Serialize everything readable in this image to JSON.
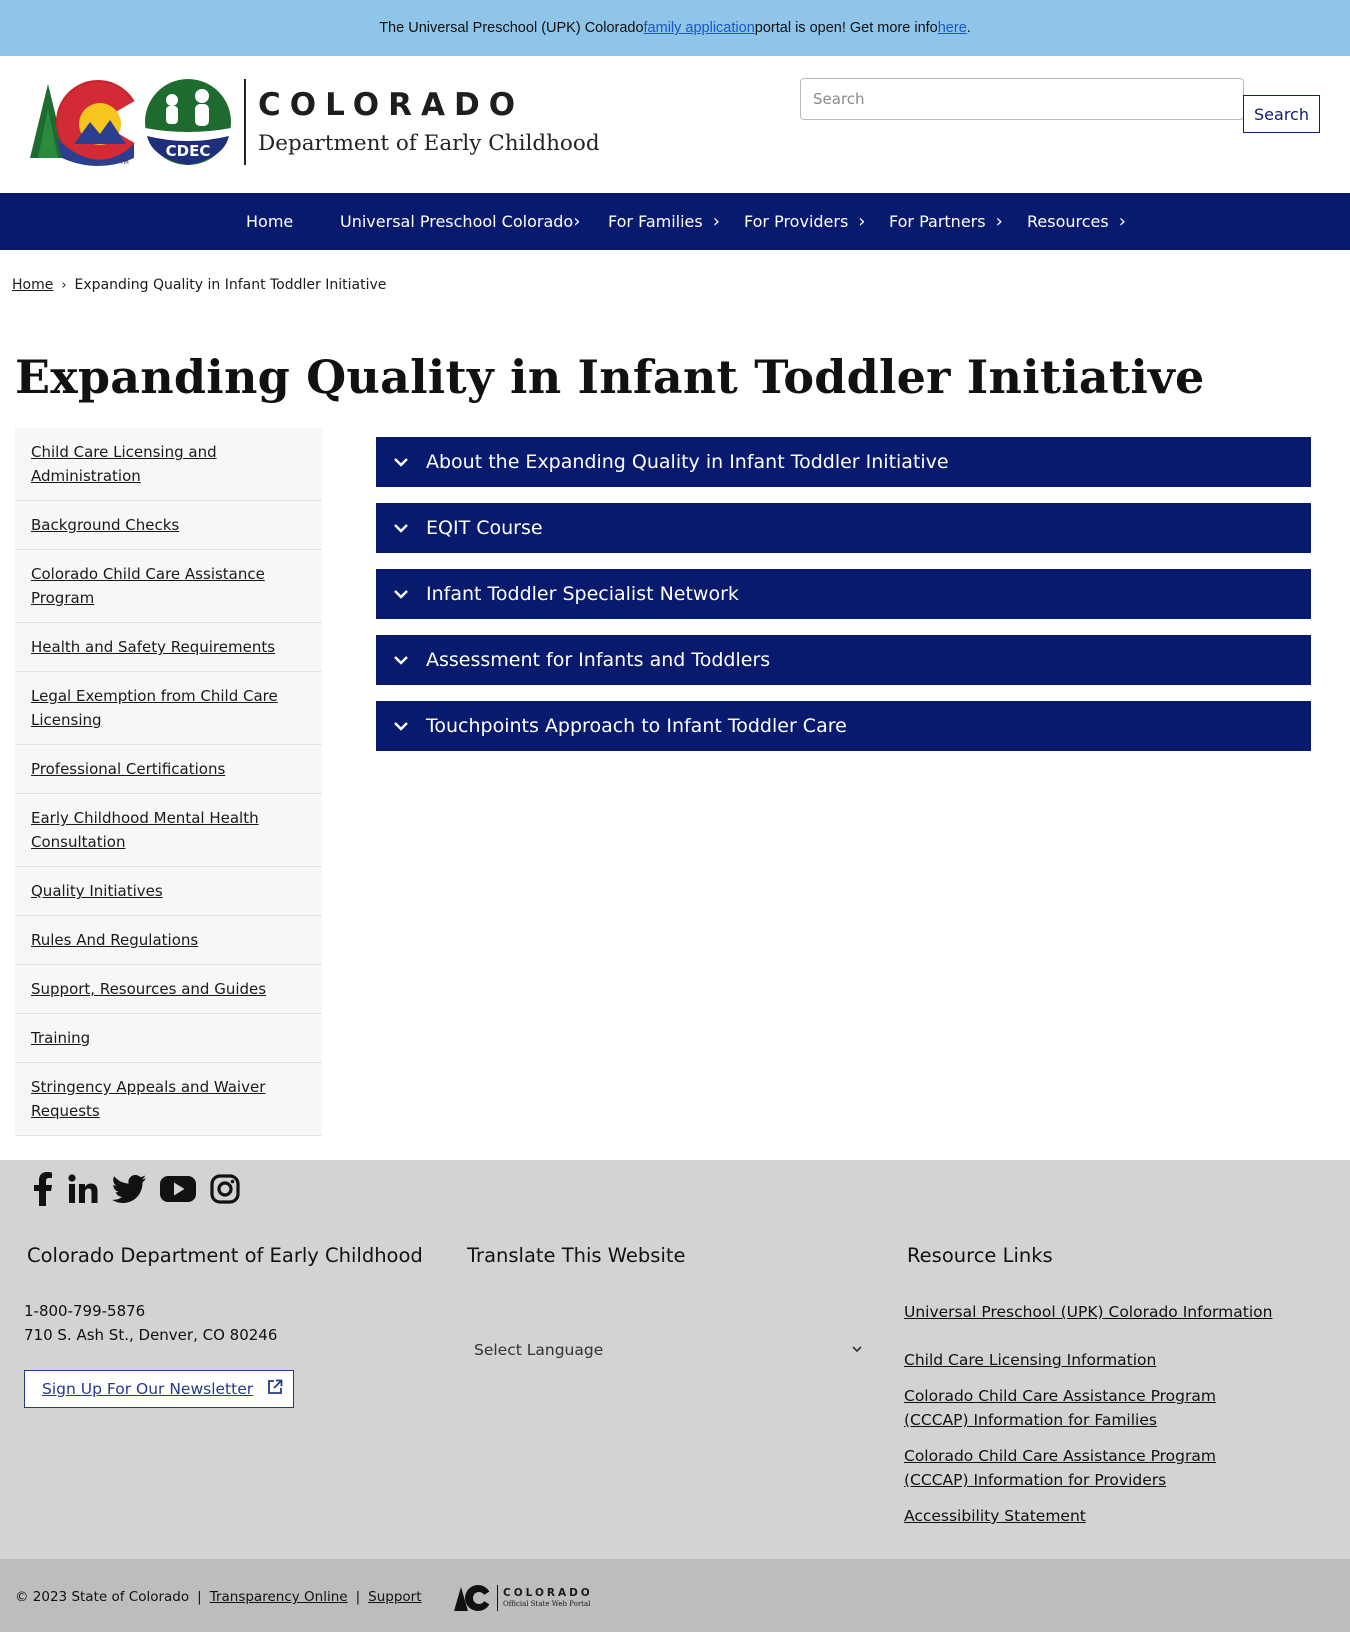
{
  "announcement": {
    "before": "The Universal Preschool (UPK) Colorado ",
    "link1": "family application",
    "middle": " portal is open! Get more info ",
    "link2": "here",
    "after": "."
  },
  "header": {
    "logo_badge": "CDEC",
    "brand_title": "COLORADO",
    "brand_subtitle": "Department of Early Childhood",
    "search_placeholder": "Search",
    "search_button": "Search"
  },
  "nav": {
    "items": [
      {
        "label": "Home"
      },
      {
        "label": "Universal Preschool Colorado"
      },
      {
        "label": "For Families"
      },
      {
        "label": "For Providers"
      },
      {
        "label": "For Partners"
      },
      {
        "label": "Resources"
      }
    ]
  },
  "breadcrumb": {
    "home": "Home",
    "current": "Expanding Quality in Infant Toddler Initiative"
  },
  "page_title": "Expanding Quality in Infant Toddler Initiative",
  "sidebar": {
    "items": [
      "Child Care Licensing and Administration",
      "Background Checks",
      "Colorado Child Care Assistance Program",
      "Health and Safety Requirements",
      "Legal Exemption from Child Care Licensing",
      "Professional Certifications",
      "Early Childhood Mental Health Consultation",
      "Quality Initiatives",
      "Rules And Regulations",
      "Support, Resources and Guides",
      "Training",
      "Stringency Appeals and Waiver Requests"
    ]
  },
  "accordions": [
    "About the Expanding Quality in Infant Toddler Initiative",
    "EQIT Course",
    "Infant Toddler Specialist Network",
    "Assessment for Infants and Toddlers",
    "Touchpoints Approach to Infant Toddler Care"
  ],
  "footer": {
    "social_icons": [
      "facebook-icon",
      "linkedin-icon",
      "twitter-icon",
      "youtube-icon",
      "instagram-icon"
    ],
    "org_heading": "Colorado Department of Early Childhood",
    "phone": "1-800-799-5876",
    "address": "710 S. Ash St., Denver, CO 80246",
    "newsletter": "Sign Up For Our Newsletter",
    "translate_heading": "Translate This Website",
    "language_select": "Select Language",
    "resources_heading": "Resource Links",
    "resource_links": [
      "Universal Preschool (UPK) Colorado Information",
      "Child Care Licensing Information",
      "Colorado Child Care Assistance Program (CCCAP) Information for Families",
      "Colorado Child Care Assistance Program (CCCAP) Information for Providers",
      "Accessibility Statement"
    ]
  },
  "bottom": {
    "copyright": "© 2023 State of Colorado",
    "sep": "|",
    "transparency": "Transparency Online",
    "support": "Support",
    "portal_title": "COLORADO",
    "portal_sub": "Official State Web Portal"
  },
  "colors": {
    "announcement_bg": "#8ec5e8",
    "nav_bg": "#081a6e",
    "footer_bg": "#d3d3d3",
    "bottom_bg": "#bdbdbd"
  }
}
